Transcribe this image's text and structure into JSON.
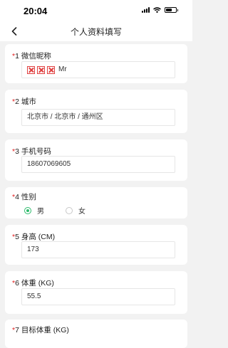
{
  "status_bar": {
    "time": "20:04"
  },
  "nav": {
    "title": "个人资料填写"
  },
  "form": {
    "nickname": {
      "req": "*",
      "label": "1 微信昵称",
      "value": "Mr"
    },
    "city": {
      "req": "*",
      "label": "2 城市",
      "value": "北京市 / 北京市 / 通州区"
    },
    "phone": {
      "req": "*",
      "label": "3 手机号码",
      "value": "18607069605"
    },
    "gender": {
      "req": "*",
      "label": "4 性别",
      "options": [
        {
          "label": "男",
          "selected": true
        },
        {
          "label": "女",
          "selected": false
        }
      ]
    },
    "height": {
      "req": "*",
      "label": "5 身高 (CM)",
      "value": "173"
    },
    "weight": {
      "req": "*",
      "label": "6 体重 (KG)",
      "value": "55.5"
    },
    "target_weight": {
      "req": "*",
      "label": "7 目标体重 (KG)"
    }
  },
  "colors": {
    "required": "#e02020",
    "radio_selected": "#2dbb6c",
    "background": "#f2f2f2"
  }
}
